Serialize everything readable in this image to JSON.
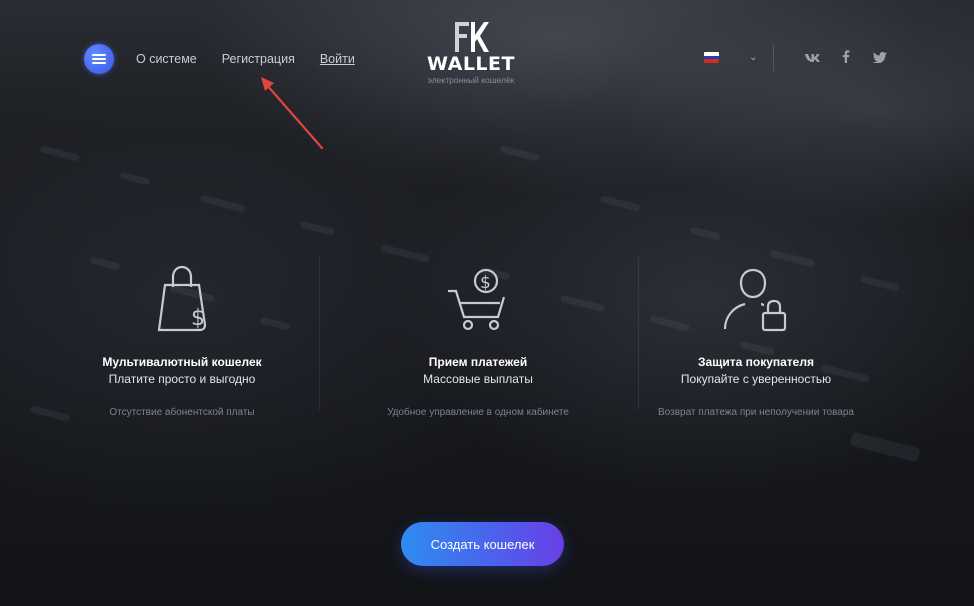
{
  "header": {
    "nav": [
      {
        "label": "О системе"
      },
      {
        "label": "Регистрация"
      },
      {
        "label": "Войти"
      }
    ],
    "logo": {
      "mark": "FK",
      "name": "WALLET",
      "tagline": "электронный кошелёк"
    },
    "language": {
      "flag_colors": [
        "#ffffff",
        "#1d3fb8",
        "#d52b1e"
      ]
    },
    "social": [
      {
        "icon": "vk-icon",
        "label": "vk"
      },
      {
        "icon": "facebook-icon",
        "label": "f"
      },
      {
        "icon": "twitter-icon",
        "label": "twitter"
      }
    ]
  },
  "features": [
    {
      "icon": "shopping-bag-dollar-icon",
      "title": "Мультивалютный кошелек",
      "subtitle": "Платите просто и выгодно",
      "description": "Отсутствие абонентской платы"
    },
    {
      "icon": "cart-dollar-icon",
      "title": "Прием платежей",
      "subtitle": "Массовые выплаты",
      "description": "Удобное управление в одном кабинете"
    },
    {
      "icon": "user-lock-icon",
      "title": "Защита покупателя",
      "subtitle": "Покупайте с уверенностью",
      "description": "Возврат платежа при неполучении товара"
    }
  ],
  "cta": {
    "label": "Создать кошелек"
  },
  "colors": {
    "accent_start": "#2f8cf0",
    "accent_end": "#6a3fe6",
    "annotation_arrow": "#e2453c"
  }
}
